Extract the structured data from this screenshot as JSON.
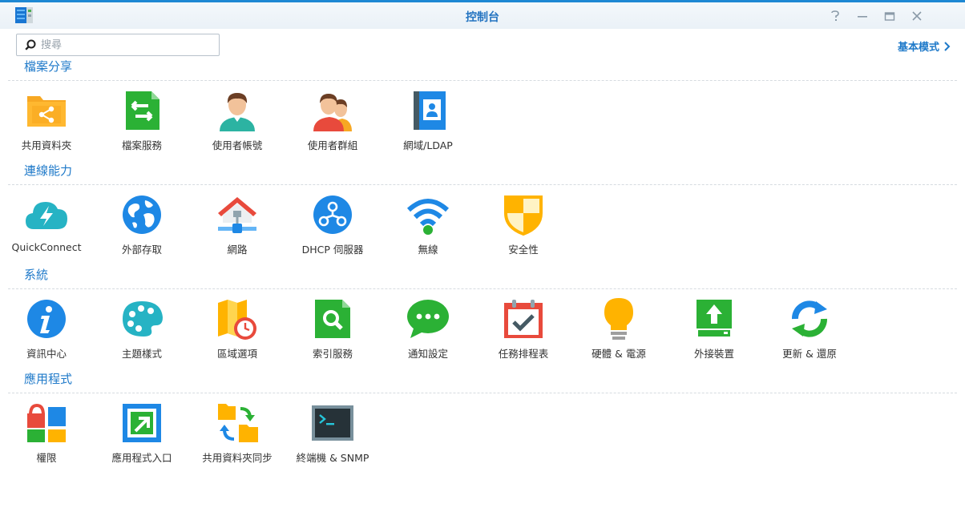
{
  "window": {
    "title": "控制台",
    "controls": [
      "help-icon",
      "minimize-icon",
      "maximize-icon",
      "close-icon"
    ]
  },
  "search": {
    "placeholder": "搜尋",
    "value": ""
  },
  "mode_link": {
    "label": "基本模式"
  },
  "sections": [
    {
      "title": "檔案分享",
      "items": [
        {
          "label": "共用資料夾",
          "icon": "shared-folder-icon"
        },
        {
          "label": "檔案服務",
          "icon": "file-services-icon"
        },
        {
          "label": "使用者帳號",
          "icon": "user-icon"
        },
        {
          "label": "使用者群組",
          "icon": "group-icon"
        },
        {
          "label": "網域/LDAP",
          "icon": "domain-ldap-icon"
        }
      ]
    },
    {
      "title": "連線能力",
      "items": [
        {
          "label": "QuickConnect",
          "icon": "quickconnect-icon"
        },
        {
          "label": "外部存取",
          "icon": "external-access-icon"
        },
        {
          "label": "網路",
          "icon": "network-icon"
        },
        {
          "label": "DHCP 伺服器",
          "icon": "dhcp-server-icon"
        },
        {
          "label": "無線",
          "icon": "wireless-icon"
        },
        {
          "label": "安全性",
          "icon": "security-icon"
        }
      ]
    },
    {
      "title": "系統",
      "items": [
        {
          "label": "資訊中心",
          "icon": "info-center-icon"
        },
        {
          "label": "主題樣式",
          "icon": "theme-palette-icon"
        },
        {
          "label": "區域選項",
          "icon": "regional-options-icon"
        },
        {
          "label": "索引服務",
          "icon": "indexing-service-icon"
        },
        {
          "label": "通知設定",
          "icon": "notification-icon"
        },
        {
          "label": "任務排程表",
          "icon": "task-scheduler-icon"
        },
        {
          "label": "硬體 & 電源",
          "icon": "hardware-power-icon"
        },
        {
          "label": "外接裝置",
          "icon": "external-devices-icon"
        },
        {
          "label": "更新 & 還原",
          "icon": "update-restore-icon"
        }
      ]
    },
    {
      "title": "應用程式",
      "items": [
        {
          "label": "權限",
          "icon": "privileges-icon"
        },
        {
          "label": "應用程式入口",
          "icon": "application-portal-icon"
        },
        {
          "label": "共用資料夾同步",
          "icon": "shared-folder-sync-icon"
        },
        {
          "label": "終端機 & SNMP",
          "icon": "terminal-snmp-icon"
        }
      ]
    }
  ],
  "colors": {
    "accent": "#1e79c9",
    "title_bar_border": "#1e88d3"
  }
}
